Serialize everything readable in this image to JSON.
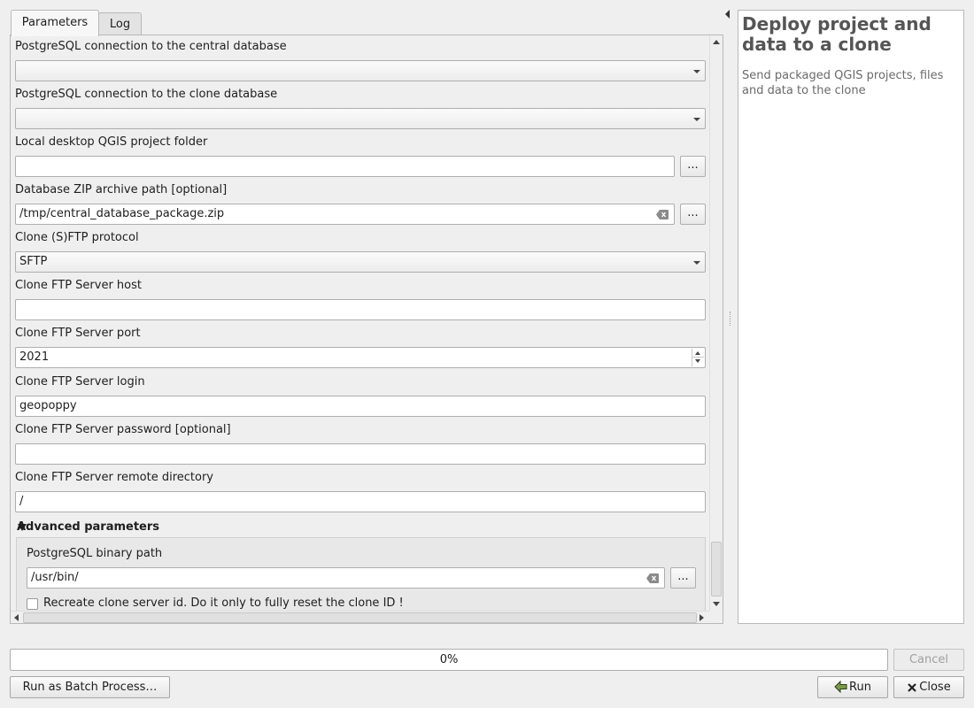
{
  "tabs": [
    {
      "label": "Parameters"
    },
    {
      "label": "Log"
    }
  ],
  "parameters": {
    "central_db": {
      "label": "PostgreSQL connection to the central database",
      "value": ""
    },
    "clone_db": {
      "label": "PostgreSQL connection to the clone database",
      "value": ""
    },
    "project_folder": {
      "label": "Local desktop QGIS project folder",
      "value": "",
      "browse": "..."
    },
    "zip_path": {
      "label": "Database ZIP archive path [optional]",
      "value": "/tmp/central_database_package.zip",
      "browse": "..."
    },
    "protocol": {
      "label": "Clone (S)FTP protocol",
      "value": "SFTP"
    },
    "ftp_host": {
      "label": "Clone FTP Server host",
      "value": ""
    },
    "ftp_port": {
      "label": "Clone FTP Server port",
      "value": "2021"
    },
    "ftp_login": {
      "label": "Clone FTP Server login",
      "value": "geopoppy"
    },
    "ftp_password": {
      "label": "Clone FTP Server password [optional]",
      "value": ""
    },
    "ftp_remote_dir": {
      "label": "Clone FTP Server remote directory",
      "value": "/"
    }
  },
  "advanced": {
    "title": "Advanced parameters",
    "binary_path": {
      "label": "PostgreSQL binary path",
      "value": "/usr/bin/",
      "browse": "..."
    },
    "recreate_id": {
      "label": "Recreate clone server id. Do it only to fully reset the clone ID !",
      "checked": false
    }
  },
  "help": {
    "title": "Deploy project and data to a clone",
    "description": "Send packaged QGIS projects, files and data to the clone"
  },
  "footer": {
    "progress": "0%",
    "progress_value": 0,
    "cancel": "Cancel",
    "batch": "Run as Batch Process…",
    "run": "Run",
    "close": "Close"
  }
}
